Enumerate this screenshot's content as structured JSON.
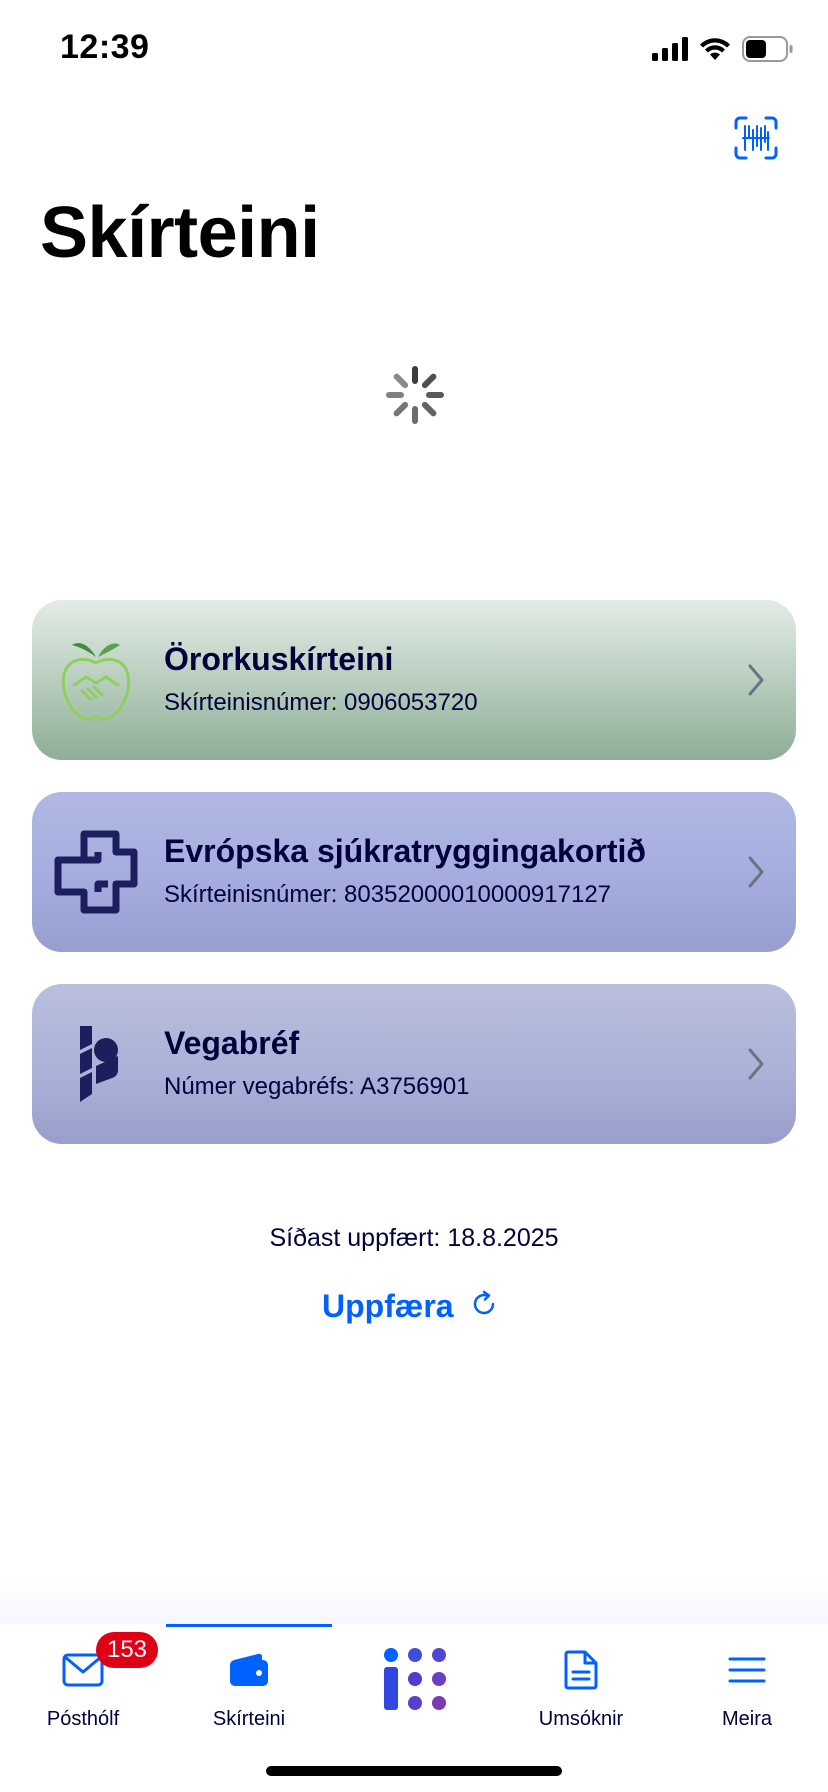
{
  "status_bar": {
    "time": "12:39",
    "icons": [
      "cellular-signal-icon",
      "wifi-icon",
      "battery-icon"
    ]
  },
  "header": {
    "title": "Skírteini",
    "scan_icon": "qr-scan-icon"
  },
  "loading": {
    "icon": "activity-spinner-icon"
  },
  "cards": [
    {
      "title": "Örorkuskírteini",
      "subtitle": "Skírteinisnúmer: 0906053720",
      "icon": "apple-handshake-icon"
    },
    {
      "title": "Evrópska sjúkratryggingakortið",
      "subtitle": "Skírteinisnúmer: 80352000010000917127",
      "icon": "health-cross-icon"
    },
    {
      "title": "Vegabréf",
      "subtitle": "Númer vegabréfs: A3756901",
      "icon": "island-is-logo-icon"
    }
  ],
  "footer": {
    "last_updated": "Síðast uppfært: 18.8.2025",
    "refresh_label": "Uppfæra"
  },
  "tab_bar": {
    "tabs": [
      {
        "label": "Pósthólf",
        "icon": "envelope-icon",
        "badge": "153"
      },
      {
        "label": "Skírteini",
        "icon": "wallet-icon",
        "active": true
      },
      {
        "label": "",
        "icon": "island-is-dots-icon"
      },
      {
        "label": "Umsóknir",
        "icon": "document-icon"
      },
      {
        "label": "Meira",
        "icon": "menu-icon"
      }
    ]
  },
  "colors": {
    "accent": "#0061ff",
    "text": "#00003c",
    "badge": "#e00016"
  }
}
